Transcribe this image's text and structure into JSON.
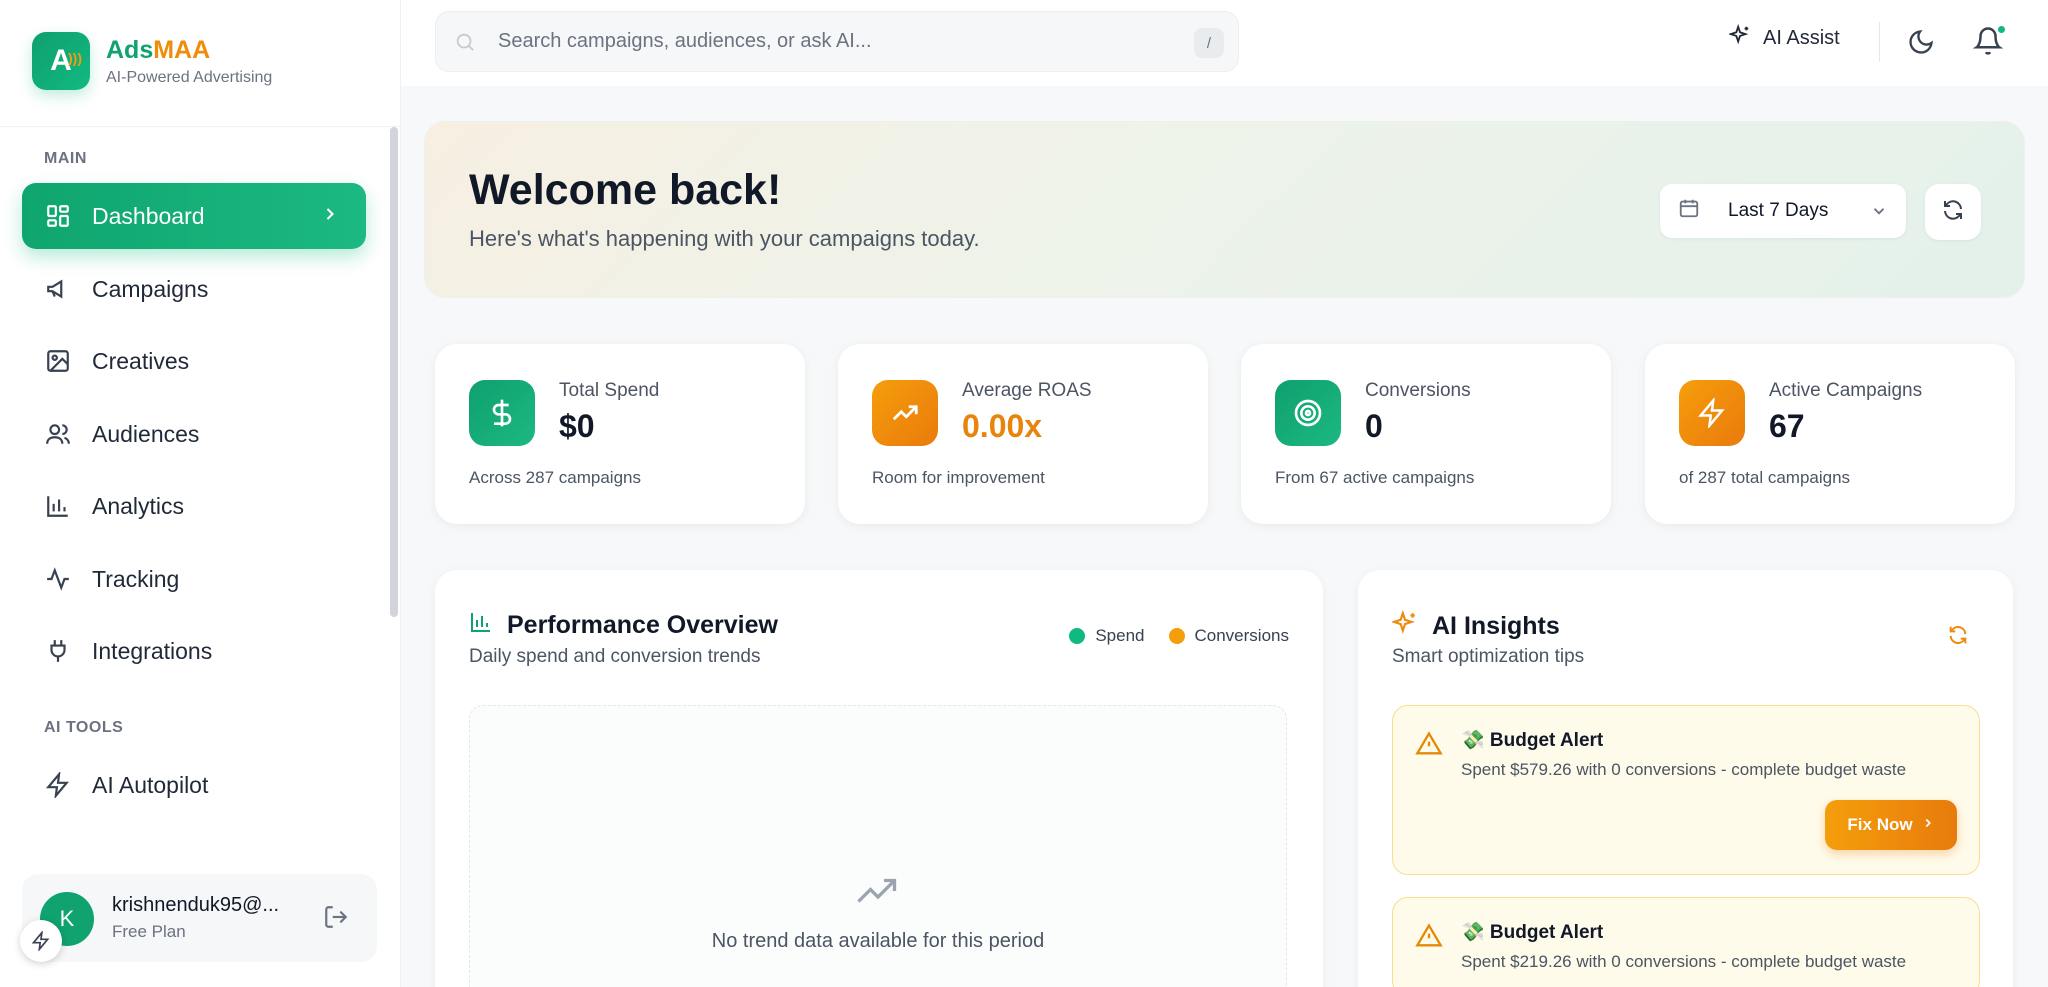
{
  "brand": {
    "initial": "A",
    "name_part1": "Ads",
    "name_part2": "MAA",
    "tagline": "AI-Powered Advertising"
  },
  "sidebar": {
    "main_label": "MAIN",
    "items": [
      {
        "label": "Dashboard",
        "icon": "dashboard-icon"
      },
      {
        "label": "Campaigns",
        "icon": "megaphone-icon"
      },
      {
        "label": "Creatives",
        "icon": "image-icon"
      },
      {
        "label": "Audiences",
        "icon": "users-icon"
      },
      {
        "label": "Analytics",
        "icon": "bar-chart-icon"
      },
      {
        "label": "Tracking",
        "icon": "activity-icon"
      },
      {
        "label": "Integrations",
        "icon": "plug-icon"
      }
    ],
    "ai_tools_label": "AI TOOLS",
    "ai_items": [
      {
        "label": "AI Autopilot",
        "icon": "zap-icon"
      }
    ]
  },
  "user": {
    "initial": "K",
    "email": "krishnenduk95@...",
    "plan": "Free Plan"
  },
  "header": {
    "search_placeholder": "Search campaigns, audiences, or ask AI...",
    "search_shortcut": "/",
    "ai_assist": "AI Assist"
  },
  "welcome": {
    "title": "Welcome back!",
    "subtitle": "Here's what's happening with your campaigns today.",
    "date_range": "Last 7 Days"
  },
  "stats": [
    {
      "label": "Total Spend",
      "value": "$0",
      "foot": "Across 287 campaigns",
      "color": "#10a36f"
    },
    {
      "label": "Average ROAS",
      "value": "0.00x",
      "foot": "Room for improvement",
      "color": "#f08c0a"
    },
    {
      "label": "Conversions",
      "value": "0",
      "foot": "From 67 active campaigns",
      "color": "#10a36f"
    },
    {
      "label": "Active Campaigns",
      "value": "67",
      "foot": "of 287 total campaigns",
      "color": "#f08c0a"
    }
  ],
  "performance": {
    "title": "Performance Overview",
    "subtitle": "Daily spend and conversion trends",
    "legend": [
      {
        "name": "Spend",
        "color": "#10b981"
      },
      {
        "name": "Conversions",
        "color": "#f59e0b"
      }
    ],
    "empty_text": "No trend data available for this period"
  },
  "insights": {
    "title": "AI Insights",
    "subtitle": "Smart optimization tips",
    "alerts": [
      {
        "title": "💸 Budget Alert",
        "desc": "Spent $579.26 with 0 conversions - complete budget waste",
        "action": "Fix Now"
      },
      {
        "title": "💸 Budget Alert",
        "desc": "Spent $219.26 with 0 conversions - complete budget waste"
      }
    ]
  }
}
